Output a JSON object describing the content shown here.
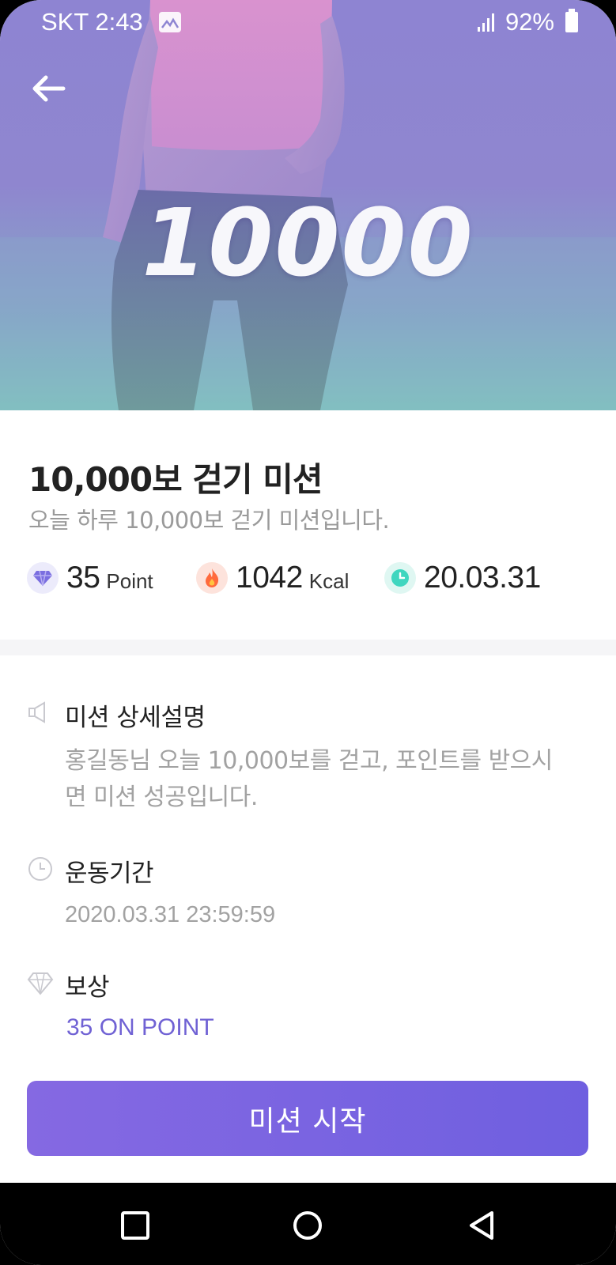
{
  "status_bar": {
    "carrier_time": "SKT 2:43",
    "battery": "92%",
    "icons": [
      "gallery-icon",
      "signal-icon",
      "battery-icon"
    ]
  },
  "hero": {
    "number": "10000",
    "back_icon": "arrow-left-icon"
  },
  "mission": {
    "title": "10,000보 걷기 미션",
    "subtitle": "오늘 하루 10,000보 걷기 미션입니다.",
    "stats": [
      {
        "icon": "diamond-icon",
        "value": "35",
        "unit": "Point"
      },
      {
        "icon": "flame-icon",
        "value": "1042",
        "unit": "Kcal"
      },
      {
        "icon": "clock-icon",
        "value": "20.03.31",
        "unit": ""
      }
    ]
  },
  "details": {
    "description": {
      "title": "미션 상세설명",
      "text": "홍길동님 오늘 10,000보를 걷고, 포인트를 받으시면 미션 성공입니다."
    },
    "period": {
      "title": "운동기간",
      "value": "2020.03.31 23:59:59"
    },
    "reward": {
      "title": "보상",
      "value": "35 ON POINT"
    }
  },
  "cta": {
    "label": "미션 시작"
  },
  "colors": {
    "accent": "#7062d4",
    "button_start": "#8569e2",
    "button_end": "#6f5fe0",
    "point_icon_bg": "#ecebfb",
    "flame_icon_bg": "#fde3dc",
    "clock_icon_bg": "#dff7f2"
  },
  "nav": {
    "icons": [
      "recents-square-icon",
      "home-circle-icon",
      "back-triangle-icon"
    ]
  }
}
